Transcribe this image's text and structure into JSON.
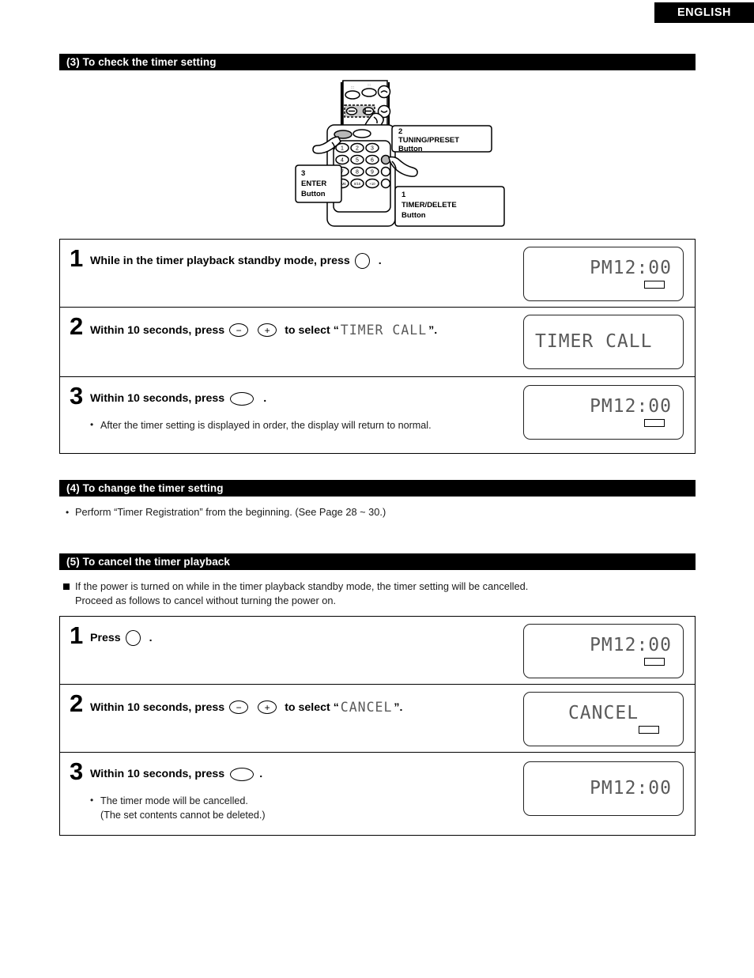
{
  "page": {
    "language_tag": "ENGLISH"
  },
  "sections": {
    "s3": {
      "heading": "(3) To check the timer setting"
    },
    "s4": {
      "heading": "(4) To change the timer setting",
      "note": "Perform “Timer Registration” from the beginning. (See Page 28 ~ 30.)"
    },
    "s5": {
      "heading": "(5) To cancel the timer playback",
      "note_line1": "If the power is turned on while in the timer playback standby mode, the timer setting will be cancelled.",
      "note_line2": "Proceed as follows to cancel without turning the power on."
    }
  },
  "remote_diagram": {
    "callouts": [
      {
        "number": "2",
        "name": "TUNING/PRESET",
        "suffix": "Button"
      },
      {
        "number": "3",
        "name": "ENTER",
        "suffix": "Button"
      },
      {
        "number": "1",
        "name": "TIMER/DELETE",
        "suffix": "Button"
      }
    ],
    "keypad": [
      "1",
      "2",
      "3",
      "4",
      "5",
      "6",
      "7",
      "8",
      "9",
      "TIME",
      "0/10",
      "+10"
    ]
  },
  "steps_check": [
    {
      "number": "1",
      "text_before": "While in the timer playback standby mode, press",
      "button": "circle",
      "text_after": "",
      "period": ".",
      "lcd": {
        "line": "PM12:00",
        "align": "right",
        "indicator": true
      },
      "sub_note": ""
    },
    {
      "number": "2",
      "text_before": "Within 10 seconds, press",
      "button": "minus-plus",
      "text_mid": "to select “",
      "dm_value": "TIMER CALL",
      "text_after": "”.",
      "lcd": {
        "line": "TIMER CALL",
        "align": "left",
        "indicator": false
      },
      "sub_note": ""
    },
    {
      "number": "3",
      "text_before": "Within 10 seconds, press",
      "button": "ellipse",
      "period": ".",
      "lcd": {
        "line": "PM12:00",
        "align": "right",
        "indicator": true
      },
      "sub_note": "After the timer setting is displayed in order, the display will return to normal."
    }
  ],
  "steps_cancel": [
    {
      "number": "1",
      "text_before": "Press",
      "button": "circle",
      "period": ".",
      "lcd": {
        "line": "PM12:00",
        "align": "right",
        "indicator": true
      },
      "sub_note": ""
    },
    {
      "number": "2",
      "text_before": "Within 10 seconds, press",
      "button": "minus-plus",
      "text_mid": "to select “",
      "dm_value": "CANCEL",
      "text_after": "”.",
      "lcd": {
        "line": "CANCEL",
        "align": "center",
        "indicator": true
      },
      "sub_note": ""
    },
    {
      "number": "3",
      "text_before": "Within 10 seconds, press",
      "button": "ellipse",
      "period": ".",
      "lcd": {
        "line": "PM12:00",
        "align": "right",
        "indicator": false
      },
      "sub_note_line1": "The timer mode will be cancelled.",
      "sub_note_line2": "(The set contents cannot be deleted.)"
    }
  ],
  "glyphs": {
    "minus": "−",
    "plus": "+",
    "bullet": "•"
  }
}
